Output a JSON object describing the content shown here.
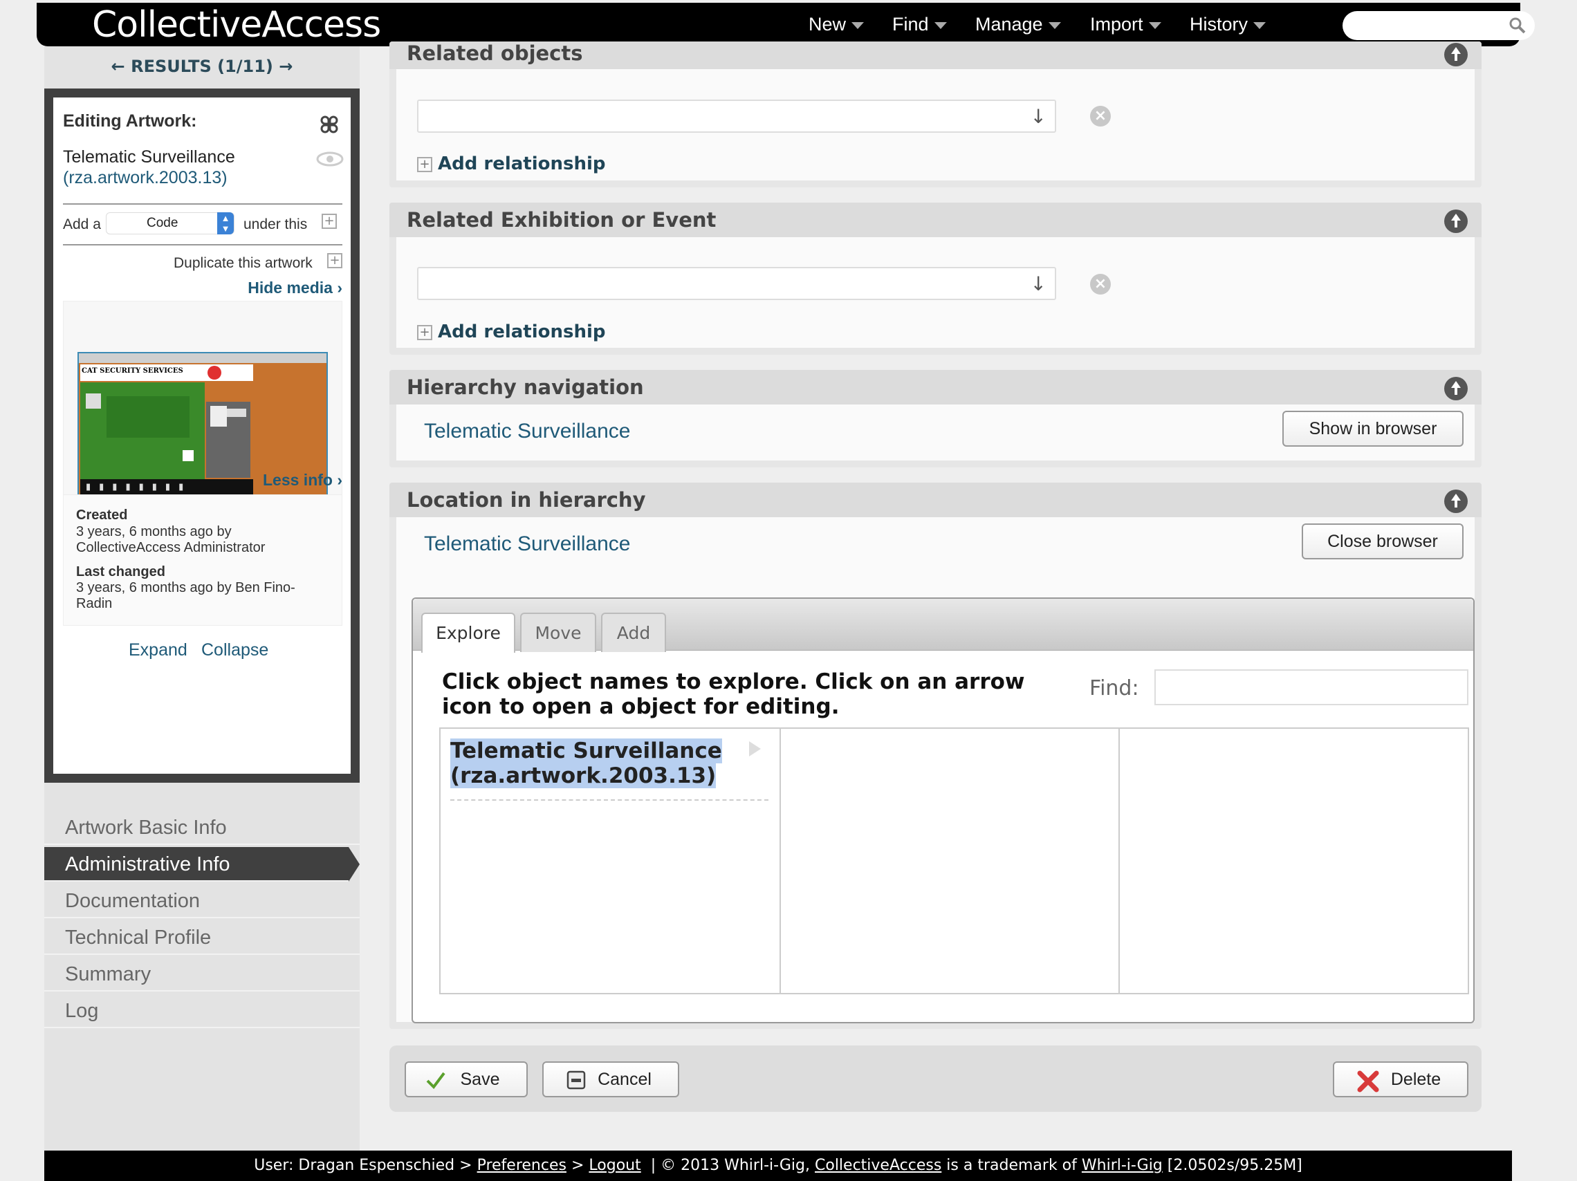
{
  "app": {
    "logo": "CollectiveAccess"
  },
  "topnav": {
    "items": [
      {
        "label": "New"
      },
      {
        "label": "Find"
      },
      {
        "label": "Manage"
      },
      {
        "label": "Import"
      },
      {
        "label": "History"
      }
    ],
    "search_placeholder": ""
  },
  "sidebar": {
    "results": "← RESULTS (1/11) →",
    "editing_label": "Editing Artwork:",
    "record_title": "Telematic Surveillance",
    "record_id": "(rza.artwork.2003.13)",
    "add_a": "Add a",
    "add_type": "Code",
    "under_this": "under this",
    "duplicate": "Duplicate this artwork",
    "hide_media": "Hide media ›",
    "less_info": "Less info ›",
    "created_label": "Created",
    "created_value": "3 years, 6 months ago by CollectiveAccess Administrator",
    "changed_label": "Last changed",
    "changed_value": "3 years, 6 months ago by Ben Fino-Radin",
    "expand": "Expand",
    "collapse": "Collapse",
    "nav": [
      {
        "label": "Artwork Basic Info"
      },
      {
        "label": "Administrative Info"
      },
      {
        "label": "Documentation"
      },
      {
        "label": "Technical Profile"
      },
      {
        "label": "Summary"
      },
      {
        "label": "Log"
      }
    ]
  },
  "panels": {
    "related_objects": {
      "title": "Related objects",
      "add": "Add relationship"
    },
    "related_exhibition": {
      "title": "Related Exhibition or Event",
      "add": "Add relationship"
    },
    "hierarchy_nav": {
      "title": "Hierarchy navigation",
      "value": "Telematic Surveillance",
      "button": "Show in browser"
    },
    "location": {
      "title": "Location in hierarchy",
      "value": "Telematic Surveillance",
      "button": "Close browser",
      "tabs": [
        {
          "label": "Explore"
        },
        {
          "label": "Move"
        },
        {
          "label": "Add"
        }
      ],
      "instructions": "Click object names to explore. Click on an arrow icon to open a object for editing.",
      "find_label": "Find:",
      "item_line1": "Telematic Surveillance",
      "item_line2": "(rza.artwork.2003.13)"
    }
  },
  "actions": {
    "save": "Save",
    "cancel": "Cancel",
    "delete": "Delete"
  },
  "footer": {
    "user": "User: Dragan Espenschied >",
    "preferences": "Preferences",
    "sep1": ">",
    "logout": "Logout",
    "copy": "|  © 2013 Whirl-i-Gig,",
    "ca": "CollectiveAccess",
    "trademark": "is a trademark of",
    "wig": "Whirl-i-Gig",
    "stats": "[2.0502s/95.25M]"
  }
}
